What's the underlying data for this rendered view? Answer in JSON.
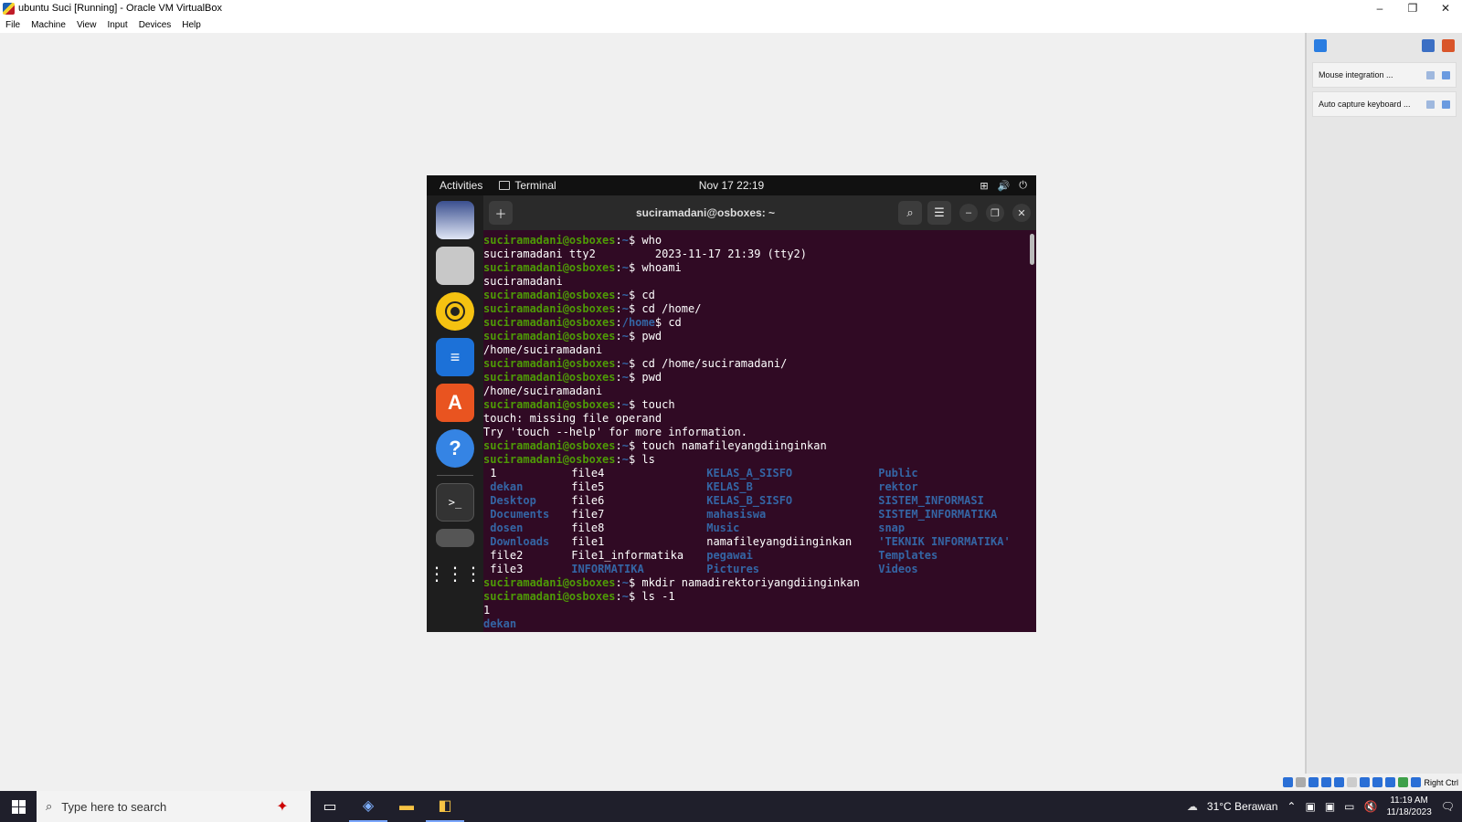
{
  "window": {
    "title": "ubuntu Suci [Running] - Oracle VM VirtualBox",
    "minimize": "–",
    "restore": "❐",
    "close": "✕"
  },
  "menu": [
    "File",
    "Machine",
    "View",
    "Input",
    "Devices",
    "Help"
  ],
  "notifications": [
    {
      "label": "Mouse integration ..."
    },
    {
      "label": "Auto capture keyboard ..."
    }
  ],
  "status_bar": {
    "host_key": "Right Ctrl"
  },
  "ubuntu": {
    "topbar": {
      "activities": "Activities",
      "app_name": "Terminal",
      "clock": "Nov 17  22:19"
    },
    "terminal": {
      "title": "suciramadani@osboxes: ~",
      "prompt_user": "suciramadani@osboxes",
      "lines": [
        {
          "type": "prompt",
          "path": "~",
          "cmd": " who"
        },
        {
          "type": "out",
          "text": "suciramadani tty2         2023-11-17 21:39 (tty2)"
        },
        {
          "type": "prompt",
          "path": "~",
          "cmd": " whoami"
        },
        {
          "type": "out",
          "text": "suciramadani"
        },
        {
          "type": "prompt",
          "path": "~",
          "cmd": " cd"
        },
        {
          "type": "prompt",
          "path": "~",
          "cmd": " cd /home/"
        },
        {
          "type": "prompt",
          "path": "/home",
          "cmd": " cd"
        },
        {
          "type": "prompt",
          "path": "~",
          "cmd": " pwd"
        },
        {
          "type": "out",
          "text": "/home/suciramadani"
        },
        {
          "type": "prompt",
          "path": "~",
          "cmd": " cd /home/suciramadani/"
        },
        {
          "type": "prompt",
          "path": "~",
          "cmd": " pwd"
        },
        {
          "type": "out",
          "text": "/home/suciramadani"
        },
        {
          "type": "prompt",
          "path": "~",
          "cmd": " touch"
        },
        {
          "type": "out",
          "text": "touch: missing file operand"
        },
        {
          "type": "out",
          "text": "Try 'touch --help' for more information."
        },
        {
          "type": "prompt",
          "path": "~",
          "cmd": " touch namafileyangdiinginkan"
        },
        {
          "type": "prompt",
          "path": "~",
          "cmd": " ls"
        }
      ],
      "ls_grid": [
        [
          {
            "t": "1",
            "d": false
          },
          {
            "t": "file4",
            "d": false
          },
          {
            "t": "KELAS_A_SISFO",
            "d": true
          },
          {
            "t": "Public",
            "d": true
          }
        ],
        [
          {
            "t": "dekan",
            "d": true
          },
          {
            "t": "file5",
            "d": false
          },
          {
            "t": "KELAS_B",
            "d": true
          },
          {
            "t": "rektor",
            "d": true
          }
        ],
        [
          {
            "t": "Desktop",
            "d": true
          },
          {
            "t": "file6",
            "d": false
          },
          {
            "t": "KELAS_B_SISFO",
            "d": true
          },
          {
            "t": "SISTEM_INFORMASI",
            "d": true
          }
        ],
        [
          {
            "t": "Documents",
            "d": true
          },
          {
            "t": "file7",
            "d": false
          },
          {
            "t": "mahasiswa",
            "d": true
          },
          {
            "t": "SISTEM_INFORMATIKA",
            "d": true
          }
        ],
        [
          {
            "t": "dosen",
            "d": true
          },
          {
            "t": "file8",
            "d": false
          },
          {
            "t": "Music",
            "d": true
          },
          {
            "t": "snap",
            "d": true
          }
        ],
        [
          {
            "t": "Downloads",
            "d": true
          },
          {
            "t": "file1",
            "d": false
          },
          {
            "t": "namafileyangdiinginkan",
            "d": false
          },
          {
            "t": "'TEKNIK INFORMATIKA'",
            "d": true
          }
        ],
        [
          {
            "t": "file2",
            "d": false
          },
          {
            "t": "File1_informatika",
            "d": false
          },
          {
            "t": "pegawai",
            "d": true
          },
          {
            "t": "Templates",
            "d": true
          }
        ],
        [
          {
            "t": "file3",
            "d": false
          },
          {
            "t": "INFORMATIKA",
            "d": true
          },
          {
            "t": "Pictures",
            "d": true
          },
          {
            "t": "Videos",
            "d": true
          }
        ]
      ],
      "after_lines": [
        {
          "type": "prompt",
          "path": "~",
          "cmd": " mkdir namadirektoriyangdiinginkan"
        },
        {
          "type": "prompt",
          "path": "~",
          "cmd": " ls -1"
        },
        {
          "type": "out",
          "text": "1"
        },
        {
          "type": "dir",
          "text": "dekan"
        }
      ]
    }
  },
  "taskbar": {
    "search_placeholder": "Type here to search",
    "weather": "31°C  Berawan",
    "time": "11:19 AM",
    "date": "11/18/2023"
  }
}
